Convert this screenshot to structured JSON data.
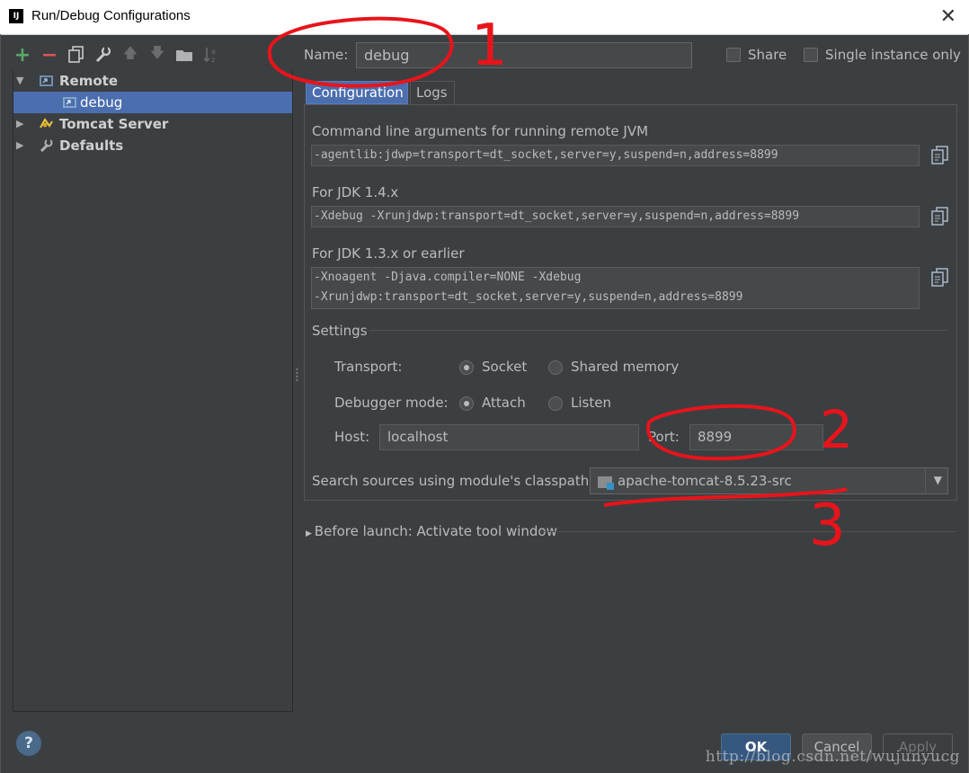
{
  "window": {
    "title": "Run/Debug Configurations",
    "app_icon_text": "IJ"
  },
  "toolbar": {
    "icons": [
      "add-icon",
      "remove-icon",
      "copy-icon",
      "wrench-icon",
      "move-up-icon",
      "move-down-icon",
      "folder-icon",
      "sort-icon"
    ]
  },
  "tree": {
    "items": [
      {
        "label": "Remote",
        "expanded": true
      },
      {
        "label": "debug",
        "selected": true
      },
      {
        "label": "Tomcat Server",
        "expanded": false
      },
      {
        "label": "Defaults",
        "expanded": false
      }
    ]
  },
  "form": {
    "name_label": "Name:",
    "name_value": "debug",
    "share_label": "Share",
    "single_instance_label": "Single instance only"
  },
  "tabs": [
    {
      "label": "Configuration",
      "active": true
    },
    {
      "label": "Logs",
      "active": false
    }
  ],
  "config": {
    "cmd_label": "Command line arguments for running remote JVM",
    "cmd_value": "-agentlib:jdwp=transport=dt_socket,server=y,suspend=n,address=8899",
    "jdk14_label": "For JDK 1.4.x",
    "jdk14_value": "-Xdebug -Xrunjdwp:transport=dt_socket,server=y,suspend=n,address=8899",
    "jdk13_label": "For JDK 1.3.x or earlier",
    "jdk13_line1": "-Xnoagent -Djava.compiler=NONE -Xdebug",
    "jdk13_line2": "-Xrunjdwp:transport=dt_socket,server=y,suspend=n,address=8899",
    "settings_label": "Settings",
    "transport_label": "Transport:",
    "transport_options": [
      "Socket",
      "Shared memory"
    ],
    "transport_selected": "Socket",
    "debugger_mode_label": "Debugger mode:",
    "debugger_mode_options": [
      "Attach",
      "Listen"
    ],
    "debugger_mode_selected": "Attach",
    "host_label": "Host:",
    "host_value": "localhost",
    "port_label": "Port:",
    "port_value": "8899",
    "classpath_label": "Search sources using module's classpath:",
    "classpath_value": "apache-tomcat-8.5.23-src"
  },
  "before_launch": "Before launch: Activate tool window",
  "buttons": {
    "help": "?",
    "ok": "OK",
    "cancel": "Cancel",
    "apply": "Apply"
  },
  "annotations": {
    "mark1": "1",
    "mark2": "2",
    "mark3": "3"
  },
  "watermark": "http://blog.csdn.net/wujunyucg",
  "colors": {
    "background": "#3c3f41",
    "selection": "#4b6eaf",
    "annotation": "#e8141b",
    "add": "#59a869",
    "remove": "#e05555"
  }
}
